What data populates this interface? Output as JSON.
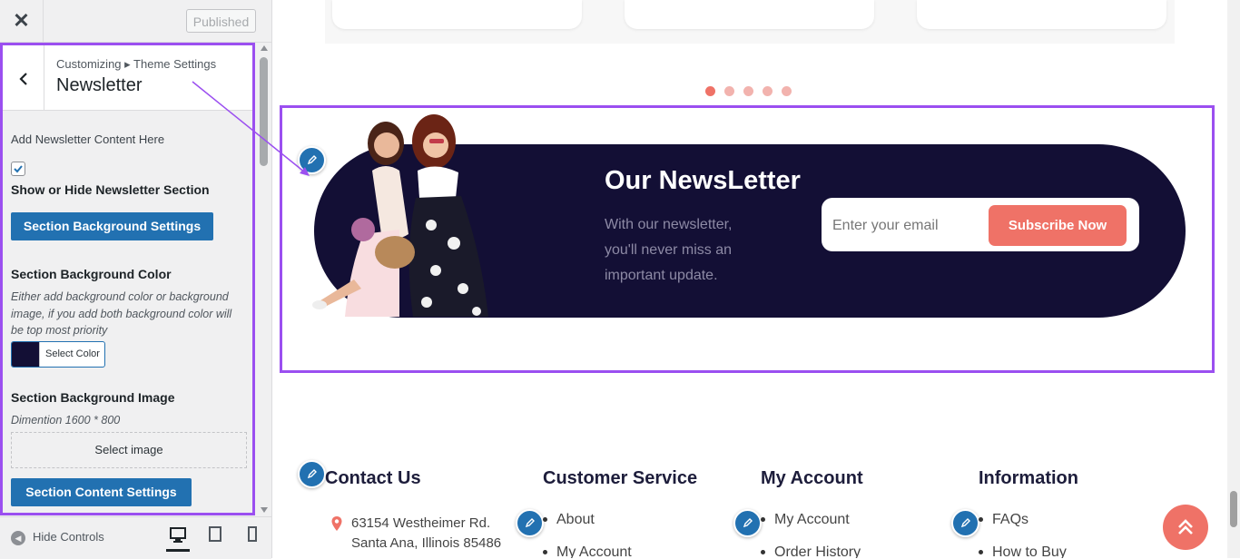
{
  "topbar": {
    "close_symbol": "✕",
    "published_label": "Published"
  },
  "panel": {
    "breadcrumb": "Customizing ▸ Theme Settings",
    "title": "Newsletter",
    "add_content_label": "Add Newsletter Content Here",
    "show_hide_checked": true,
    "show_hide_label": "Show or Hide Newsletter Section",
    "bg_settings_button": "Section Background Settings",
    "bg_color_label": "Section Background Color",
    "bg_color_desc": "Either add background color or background image, if you add both background color will be top most priority",
    "bg_color_value": "#130f35",
    "select_color_label": "Select Color",
    "bg_image_label": "Section Background Image",
    "dimension_text": "Dimention 1600 * 800",
    "select_image_label": "Select image",
    "content_settings_button": "Section Content Settings"
  },
  "footer_bar": {
    "hide_controls_label": "Hide Controls",
    "active_device": "desktop"
  },
  "preview": {
    "carousel_dots": 5,
    "carousel_active_index": 0,
    "newsletter": {
      "title": "Our NewsLetter",
      "text": "With our newsletter, you'll never miss an important update.",
      "email_placeholder": "Enter your email",
      "subscribe_label": "Subscribe Now"
    },
    "footer": {
      "contact": {
        "heading": "Contact Us",
        "address_line1": "63154 Westheimer Rd.",
        "address_line2": "Santa Ana, Illinois 85486"
      },
      "customer_service": {
        "heading": "Customer Service",
        "items": [
          "About",
          "My Account"
        ]
      },
      "my_account": {
        "heading": "My Account",
        "items": [
          "My Account",
          "Order History"
        ]
      },
      "information": {
        "heading": "Information",
        "items": [
          "FAQs",
          "How to Buy"
        ]
      }
    }
  },
  "colors": {
    "accent": "#9b4ff0",
    "wp_blue": "#2271b1",
    "coral": "#ef7267",
    "navy": "#130f35"
  }
}
